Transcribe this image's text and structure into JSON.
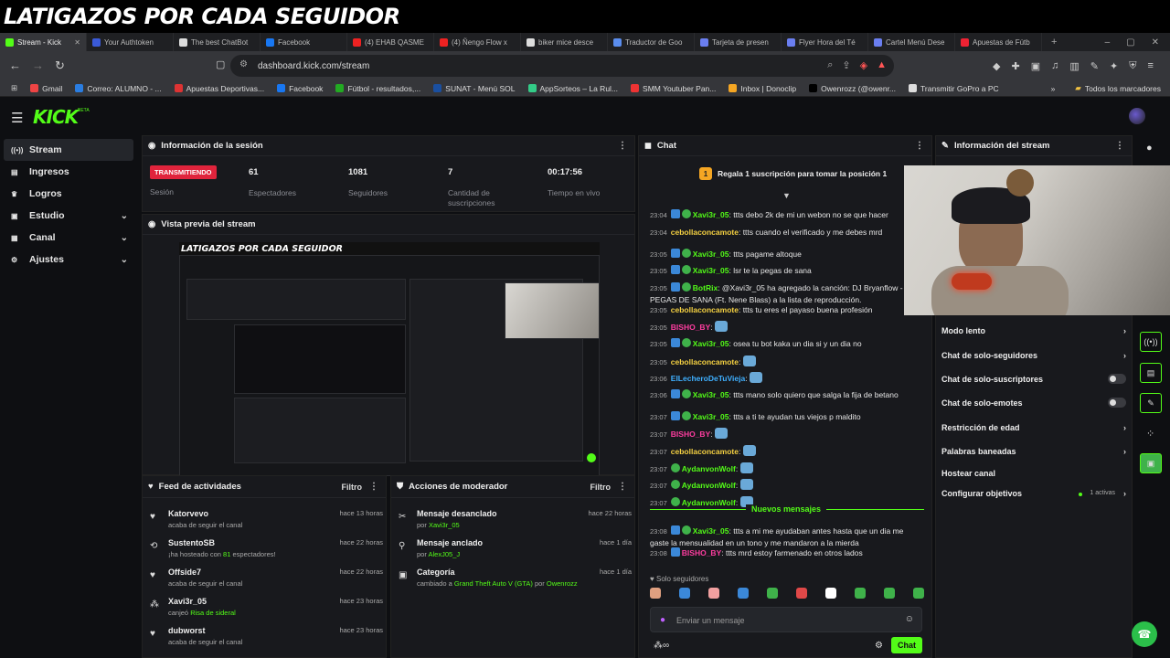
{
  "overlay_title": "LATIGAZOS POR CADA SEGUIDOR",
  "tabs": [
    {
      "label": "Stream - Kick",
      "color": "#53fc18"
    },
    {
      "label": "Your Authtoken",
      "color": "#3a5ad8"
    },
    {
      "label": "The best ChatBot",
      "color": "#ddd"
    },
    {
      "label": "Facebook",
      "color": "#1877f2"
    },
    {
      "label": "(4) EHAB QASME",
      "color": "#e22"
    },
    {
      "label": "(4) Ñengo Flow x",
      "color": "#e22"
    },
    {
      "label": "biker mice desce",
      "color": "#ddd"
    },
    {
      "label": "Traductor de Goo",
      "color": "#5a8dee"
    },
    {
      "label": "Tarjeta de presen",
      "color": "#6a7ef0"
    },
    {
      "label": "Flyer Hora del Té",
      "color": "#6a7ef0"
    },
    {
      "label": "Cartel Menú Dese",
      "color": "#6a7ef0"
    },
    {
      "label": "Apuestas de Fútb",
      "color": "#e23"
    }
  ],
  "url": "dashboard.kick.com/stream",
  "bookmarks": [
    {
      "label": "Gmail",
      "color": "#e44"
    },
    {
      "label": "Correo: ALUMNO - ...",
      "color": "#2a7de1"
    },
    {
      "label": "Apuestas Deportivas...",
      "color": "#d33"
    },
    {
      "label": "Facebook",
      "color": "#1877f2"
    },
    {
      "label": "Fútbol - resultados,...",
      "color": "#2a2"
    },
    {
      "label": "SUNAT - Menú SOL",
      "color": "#1a4fa0"
    },
    {
      "label": "AppSorteos – La Rul...",
      "color": "#3c8"
    },
    {
      "label": "SMM Youtuber Pan...",
      "color": "#e33"
    },
    {
      "label": "Inbox | Donoclip",
      "color": "#f5a623"
    },
    {
      "label": "Owenrozz (@owenr...",
      "color": "#000"
    },
    {
      "label": "Transmitir GoPro a PC",
      "color": "#ddd"
    }
  ],
  "all_bookmarks": "Todos los marcadores",
  "logo": "KICK",
  "logo_tag": "BETA",
  "sidebar": [
    {
      "label": "Stream",
      "icon": "broadcast-icon"
    },
    {
      "label": "Ingresos",
      "icon": "money-icon"
    },
    {
      "label": "Logros",
      "icon": "trophy-icon"
    },
    {
      "label": "Estudio",
      "icon": "studio-icon"
    },
    {
      "label": "Canal",
      "icon": "channel-icon"
    },
    {
      "label": "Ajustes",
      "icon": "gear-icon"
    }
  ],
  "session": {
    "title": "Información de la sesión",
    "live": "TRANSMITIENDO",
    "live_label": "Sesión",
    "stats": [
      {
        "value": "61",
        "label": "Espectadores"
      },
      {
        "value": "1081",
        "label": "Seguidores"
      },
      {
        "value": "7",
        "label": "Cantidad de suscripciones"
      },
      {
        "value": "00:17:56",
        "label": "Tiempo en vivo"
      }
    ]
  },
  "preview": {
    "title": "Vista previa del stream",
    "inner_title": "LATIGAZOS POR CADA SEGUIDOR"
  },
  "feed": {
    "title": "Feed de actividades",
    "filter": "Filtro",
    "items": [
      {
        "name": "Katorvevo",
        "desc": "acaba de seguir el canal",
        "time": "hace 13 horas",
        "icon": "heart-icon"
      },
      {
        "name": "SustentoSB",
        "desc_pre": "¡ha hosteado con ",
        "desc_hl": "81",
        "desc_post": " espectadores!",
        "time": "hace 22 horas",
        "icon": "host-icon"
      },
      {
        "name": "Offside7",
        "desc": "acaba de seguir el canal",
        "time": "hace 22 horas",
        "icon": "heart-icon"
      },
      {
        "name": "Xavi3r_05",
        "desc_pre": "canjeó ",
        "desc_hl": "Risa de sideral",
        "desc_post": "",
        "time": "hace 23 horas",
        "icon": "redeem-icon"
      },
      {
        "name": "dubworst",
        "desc": "acaba de seguir el canal",
        "time": "hace 23 horas",
        "icon": "heart-icon"
      }
    ]
  },
  "mod": {
    "title": "Acciones de moderador",
    "filter": "Filtro",
    "items": [
      {
        "name": "Mensaje desanclado",
        "by_pre": "por ",
        "by": "Xavi3r_05",
        "time": "hace 22 horas",
        "icon": "unpin-icon"
      },
      {
        "name": "Mensaje anclado",
        "by_pre": "por ",
        "by": "AlexJ05_J",
        "time": "hace 1 día",
        "icon": "pin-icon"
      },
      {
        "name": "Categoría",
        "by_pre": "cambiado a ",
        "by": "Grand Theft Auto V (GTA)",
        "by_mid": " por ",
        "by2": "Owenrozz",
        "time": "hace 1 día",
        "icon": "category-icon"
      }
    ]
  },
  "chat": {
    "title": "Chat",
    "gift": "Regala 1 suscripción para tomar la posición 1",
    "messages": [
      {
        "t": "23:04",
        "u": "Xavi3r_05",
        "c": "#53fc18",
        "b": [
          "blue",
          "grn"
        ],
        "m": "ttts debo 2k de mi un webon no se que hacer"
      },
      {
        "t": "23:04",
        "u": "cebollaconcamote",
        "c": "#f5d142",
        "b": [],
        "m": "ttts cuando el verificado y me debes mrd"
      },
      {
        "t": "23:05",
        "u": "Xavi3r_05",
        "c": "#53fc18",
        "b": [
          "blue",
          "grn"
        ],
        "m": "ttts pagame altoque"
      },
      {
        "t": "23:05",
        "u": "Xavi3r_05",
        "c": "#53fc18",
        "b": [
          "blue",
          "grn"
        ],
        "m": "lsr te la pegas de sana"
      },
      {
        "t": "23:05",
        "u": "BotRix",
        "c": "#53fc18",
        "b": [
          "blue",
          "grn"
        ],
        "m": "@Xavi3r_05 ha agregado la canción: DJ Bryanflow - TE PEGAS DE SANA (Ft. Nene Blass) a la lista de reproducción."
      },
      {
        "t": "23:05",
        "u": "cebollaconcamote",
        "c": "#f5d142",
        "b": [],
        "m": "ttts tu eres el payaso buena profesión"
      },
      {
        "t": "23:05",
        "u": "BISHO_BY",
        "c": "#ff3da0",
        "b": [],
        "m": ""
      },
      {
        "t": "23:05",
        "u": "Xavi3r_05",
        "c": "#53fc18",
        "b": [
          "blue",
          "grn"
        ],
        "m": "osea tu bot kaka un dia si y un dia no"
      },
      {
        "t": "23:05",
        "u": "cebollaconcamote",
        "c": "#f5d142",
        "b": [],
        "m": ""
      },
      {
        "t": "23:06",
        "u": "ElLecheroDeTuVieja",
        "c": "#3fb0ff",
        "b": [],
        "m": ""
      },
      {
        "t": "23:06",
        "u": "Xavi3r_05",
        "c": "#53fc18",
        "b": [
          "blue",
          "grn"
        ],
        "m": "ttts mano solo quiero que salga la fija de betano"
      },
      {
        "t": "23:07",
        "u": "Xavi3r_05",
        "c": "#53fc18",
        "b": [
          "blue",
          "grn"
        ],
        "m": "ttts a ti te ayudan tus viejos p maldito"
      },
      {
        "t": "23:07",
        "u": "BISHO_BY",
        "c": "#ff3da0",
        "b": [],
        "m": ""
      },
      {
        "t": "23:07",
        "u": "cebollaconcamote",
        "c": "#f5d142",
        "b": [],
        "m": ""
      },
      {
        "t": "23:07",
        "u": "AydanvonWolf",
        "c": "#53fc18",
        "b": [
          "grn"
        ],
        "m": ""
      },
      {
        "t": "23:07",
        "u": "AydanvonWolf",
        "c": "#53fc18",
        "b": [
          "grn"
        ],
        "m": ""
      },
      {
        "t": "23:07",
        "u": "AydanvonWolf",
        "c": "#53fc18",
        "b": [
          "grn"
        ],
        "m": ""
      }
    ],
    "new_label": "Nuevos mensajes",
    "new_messages": [
      {
        "t": "23:08",
        "u": "Xavi3r_05",
        "c": "#53fc18",
        "b": [
          "blue",
          "grn"
        ],
        "m": "ttts a mi me ayudaban antes hasta que un dia me gaste la mensualidad en un tono y me mandaron a la mierda"
      },
      {
        "t": "23:08",
        "u": "BISHO_BY",
        "c": "#ff3da0",
        "b": [
          "blue"
        ],
        "m": "ttts mrd estoy farmenado en otros lados"
      }
    ],
    "followers_only": "Solo seguidores",
    "placeholder": "Enviar un mensaje",
    "send": "Chat"
  },
  "stream_info": {
    "title": "Información del stream",
    "settings": [
      {
        "label": "Modo lento",
        "kind": "arrow"
      },
      {
        "label": "Chat de solo-seguidores",
        "kind": "arrow"
      },
      {
        "label": "Chat de solo-suscriptores",
        "kind": "toggle"
      },
      {
        "label": "Chat de solo-emotes",
        "kind": "toggle"
      },
      {
        "label": "Restricción de edad",
        "kind": "arrow"
      },
      {
        "label": "Palabras baneadas",
        "kind": "arrow"
      },
      {
        "label": "Hostear canal",
        "kind": "none"
      },
      {
        "label": "Configurar objetivos",
        "kind": "arrow",
        "extra": "1 activas"
      }
    ]
  }
}
